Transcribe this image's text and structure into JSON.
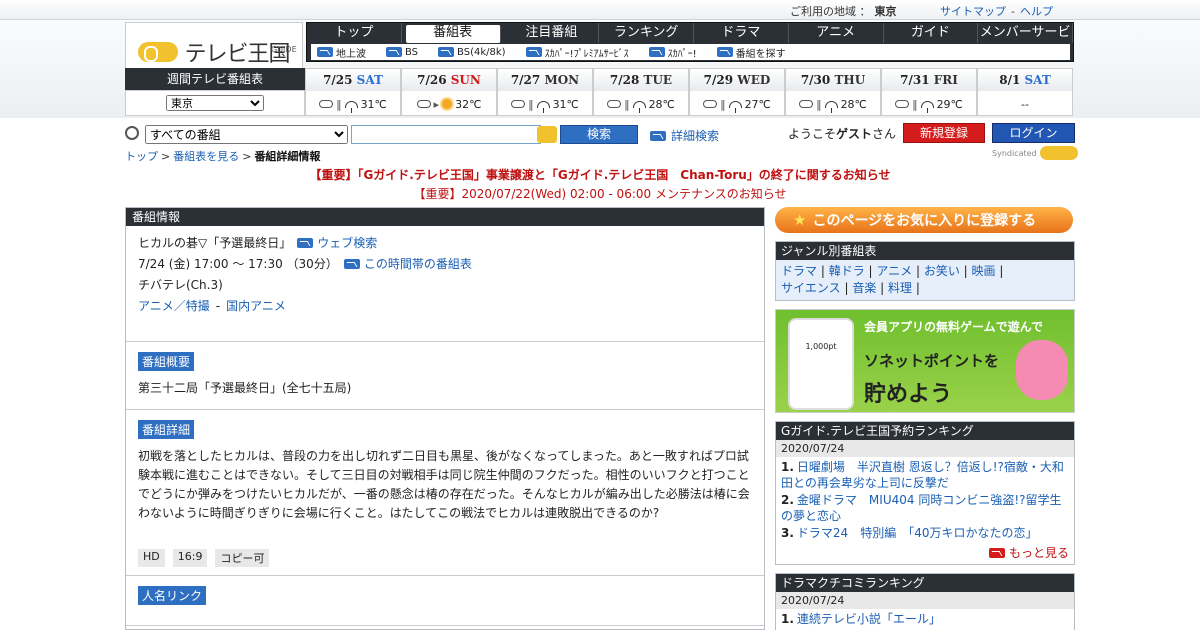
{
  "topbar": {
    "area_label": "ご利用の地域 ：",
    "area_value": "東京",
    "sitemap": "サイトマップ",
    "sep": "-",
    "help": "ヘルプ"
  },
  "logo": {
    "gtext": "GUIDE",
    "name": "テレビ王国"
  },
  "nav": {
    "tabs": [
      "トップ",
      "番組表",
      "注目番組",
      "ランキング",
      "ドラマ",
      "アニメ",
      "ガイド",
      "メンバーサービス"
    ],
    "active": 1,
    "subs": [
      "地上波",
      "BS",
      "BS(4k/8k)",
      "ｽｶﾊﾟｰ!ﾌﾟﾚﾐｱﾑｻｰﾋﾞｽ",
      "ｽｶﾊﾟｰ!",
      "番組を探す"
    ]
  },
  "week": {
    "label": "週間テレビ番組表",
    "location": "東京",
    "days": [
      {
        "date": "7/25",
        "wd": "SAT",
        "cls": "sat",
        "w1": "cloud",
        "w2": "umb",
        "sep": "‖",
        "temp": "31℃"
      },
      {
        "date": "7/26",
        "wd": "SUN",
        "cls": "sun",
        "w1": "cloud",
        "w2": "sun",
        "sep": "▸",
        "temp": "32℃"
      },
      {
        "date": "7/27",
        "wd": "MON",
        "cls": "wd",
        "w1": "cloud",
        "w2": "umb",
        "sep": "‖",
        "temp": "31℃"
      },
      {
        "date": "7/28",
        "wd": "TUE",
        "cls": "wd",
        "w1": "cloud",
        "w2": "umb",
        "sep": "‖",
        "temp": "28℃"
      },
      {
        "date": "7/29",
        "wd": "WED",
        "cls": "wd",
        "w1": "cloud",
        "w2": "umb",
        "sep": "‖",
        "temp": "27℃"
      },
      {
        "date": "7/30",
        "wd": "THU",
        "cls": "wd",
        "w1": "cloud",
        "w2": "umb",
        "sep": "‖",
        "temp": "28℃"
      },
      {
        "date": "7/31",
        "wd": "FRI",
        "cls": "wd",
        "w1": "cloud",
        "w2": "umb",
        "sep": "‖",
        "temp": "29℃"
      },
      {
        "date": "8/1",
        "wd": "SAT",
        "cls": "sat",
        "w1": "",
        "w2": "",
        "sep": "",
        "temp": "--"
      }
    ]
  },
  "search": {
    "scope": "すべての番組",
    "button": "検索",
    "advanced": "詳細検索",
    "welcome_pre": "ようこそ",
    "welcome_user": "ゲスト",
    "welcome_post": "さん",
    "register": "新規登録",
    "login": "ログイン"
  },
  "crumb": {
    "top": "トップ",
    "guide": "番組表を見る",
    "current": "番組詳細情報",
    "gt": ">"
  },
  "synd": {
    "text": "Syndicated",
    "logo": "GUIDE"
  },
  "notices": [
    "【重要】「Gガイド.テレビ王国」事業譲渡と「Gガイド.テレビ王国　Chan-Toru」の終了に関するお知らせ",
    "【重要】2020/07/22(Wed) 02:00 - 06:00 メンテナンスのお知らせ"
  ],
  "program": {
    "section": "番組情報",
    "title": "ヒカルの碁▽「予選最終日」",
    "web_search": "ウェブ検索",
    "time": "7/24 (金) 17:00 ～ 17:30 （30分）",
    "timetable": "この時間帯の番組表",
    "channel": "チバテレ(Ch.3)",
    "genre1": "アニメ／特撮",
    "genre_sep": " - ",
    "genre2": "国内アニメ",
    "summary_label": "番組概要",
    "summary": "第三十二局「予選最終日」(全七十五局)",
    "detail_label": "番組詳細",
    "detail": "初戦を落としたヒカルは、普段の力を出し切れず二日目も黒星、後がなくなってしまった。あと一敗すればプロ試験本戦に進むことはできない。そして三日目の対戦相手は同じ院生仲間のフクだった。相性のいいフクと打つことでどうにか弾みをつけたいヒカルだが、一番の懸念は椿の存在だった。そんなヒカルが編み出した必勝法は椿に会わないように時間ぎりぎりに会場に行くこと。はたしてこの戦法でヒカルは連敗脱出できるのか?",
    "tags": [
      "HD",
      "16:9",
      "コピー可"
    ],
    "person_label": "人名リンク"
  },
  "right": {
    "fav": "このページをお気に入りに登録する",
    "genre_head": "ジャンル別番組表",
    "genre_line1": [
      "ドラマ",
      "韓ドラ",
      "アニメ",
      "お笑い",
      "映画"
    ],
    "genre_line2": [
      "サイエンス",
      "音楽",
      "料理"
    ],
    "ad": {
      "t1": "会員アプリの無料ゲームで遊んで",
      "t2": "ソネットポイントを",
      "t3": "貯めよう",
      "pt": "1,000pt"
    },
    "rank1": {
      "head": "Gガイド.テレビ王国予約ランキング",
      "date": "2020/07/24",
      "items": [
        {
          "n": "1.",
          "t": "日曜劇場　半沢直樹 恩返し？倍返し!?宿敵・大和田との再会卑劣な上司に反撃だ"
        },
        {
          "n": "2.",
          "t": "金曜ドラマ　MIU404 同時コンビニ強盗!?留学生の夢と恋心"
        },
        {
          "n": "3.",
          "t": "ドラマ24　特別編　「40万キロかなたの恋」"
        }
      ],
      "more": "もっと見る"
    },
    "rank2": {
      "head": "ドラマクチコミランキング",
      "date": "2020/07/24",
      "items": [
        {
          "n": "1.",
          "t": "連続テレビ小説「エール」"
        }
      ]
    }
  }
}
